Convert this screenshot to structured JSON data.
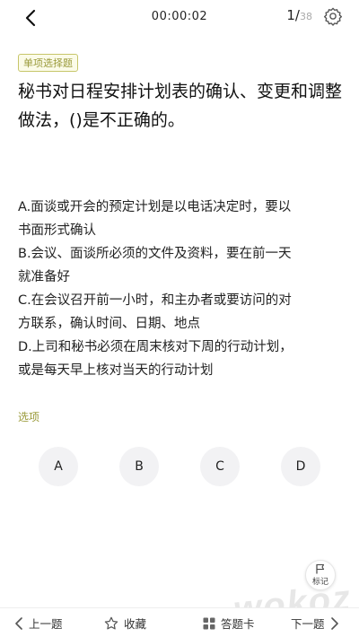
{
  "header": {
    "timer": "00:00:02",
    "current": "1/",
    "total": "38"
  },
  "question": {
    "type_tag": "单项选择题",
    "text": "秘书对日程安排计划表的确认、变更和调整做法，()是不正确的。",
    "options": [
      {
        "line1": "A.面谈或开会的预定计划是以电话决定时，要以",
        "line2": "书面形式确认"
      },
      {
        "line1": "B.会议、面谈所必须的文件及资料，要在前一天",
        "line2": "就准备好"
      },
      {
        "line1": "C.在会议召开前一小时，和主办者或要访问的对",
        "line2": "方联系，确认时间、日期、地点"
      },
      {
        "line1": "D.上司和秘书必须在周末核对下周的行动计划，",
        "line2": "或是每天早上核对当天的行动计划"
      }
    ]
  },
  "answer": {
    "label": "选项",
    "choices": [
      "A",
      "B",
      "C",
      "D"
    ]
  },
  "mark": {
    "label": "标记"
  },
  "bottom_bar": {
    "prev": "上一题",
    "favorite": "收藏",
    "answer_card": "答题卡",
    "next": "下一题"
  },
  "watermark": "wokoz",
  "colors": {
    "accent": "#9a9a3a",
    "choice_bg": "#f2f2f4"
  }
}
